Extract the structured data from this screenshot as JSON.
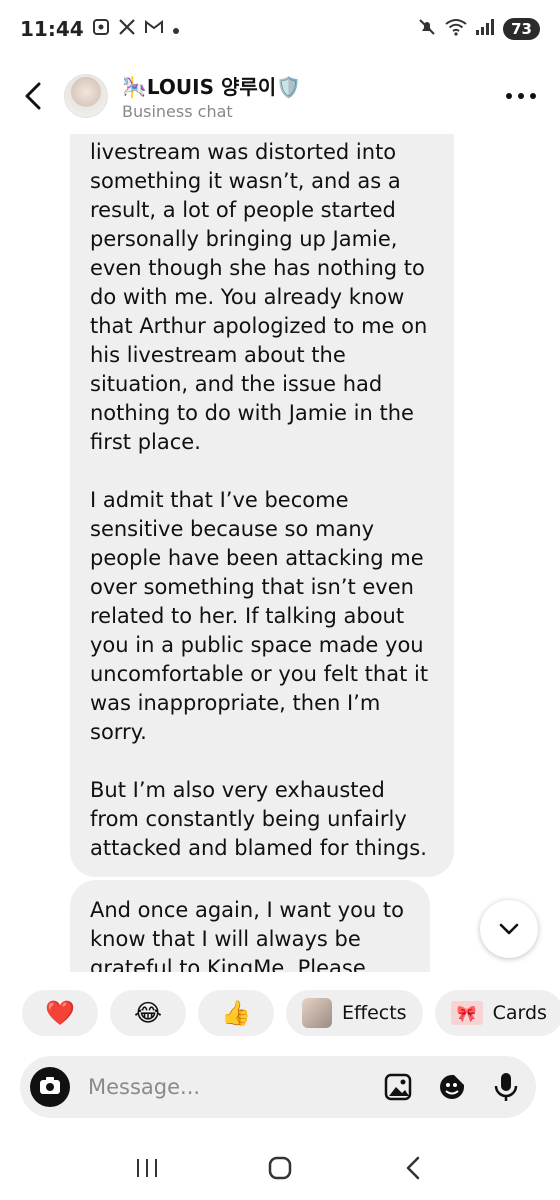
{
  "status_bar": {
    "time": "11:44",
    "battery": "73",
    "left_icons": [
      "screenshot-icon",
      "x-logo-icon",
      "gmail-icon",
      "dot-icon"
    ],
    "right_icons": [
      "mute-icon",
      "wifi-icon",
      "signal-icon",
      "battery-icon"
    ]
  },
  "header": {
    "title": "🎠LOUIS 양루이🛡️",
    "subtitle": "Business chat"
  },
  "messages": [
    {
      "text": "livestream was distorted into\nsomething it wasn’t, and as a\nresult, a lot of people started\npersonally bringing up Jamie,\neven though she has nothing to\ndo with me. You already know\nthat Arthur apologized to me on\nhis livestream about the\nsituation, and the issue had\nnothing to do with Jamie in the\nfirst place.\n\nI admit that I’ve become\nsensitive because so many\npeople have been attacking me\nover something that isn’t even\nrelated to her. If talking about\nyou in a public space made you\nuncomfortable or you felt that it\nwas inappropriate, then I’m\nsorry.\n\nBut I’m also very exhausted\nfrom constantly being unfairly\nattacked and blamed for things."
    },
    {
      "text": "And once again, I want you to\nknow that I will always be\ngrateful to KingMe. Please"
    }
  ],
  "quick_reactions": {
    "heart": "❤️",
    "laugh": "😂",
    "thumbs": "👍",
    "effects_label": "Effects",
    "cards_label": "Cards",
    "cards_icon": "🎀"
  },
  "composer": {
    "placeholder": "Message..."
  },
  "colors": {
    "bubble_bg": "#efefef",
    "text": "#111111",
    "muted": "#888888"
  }
}
